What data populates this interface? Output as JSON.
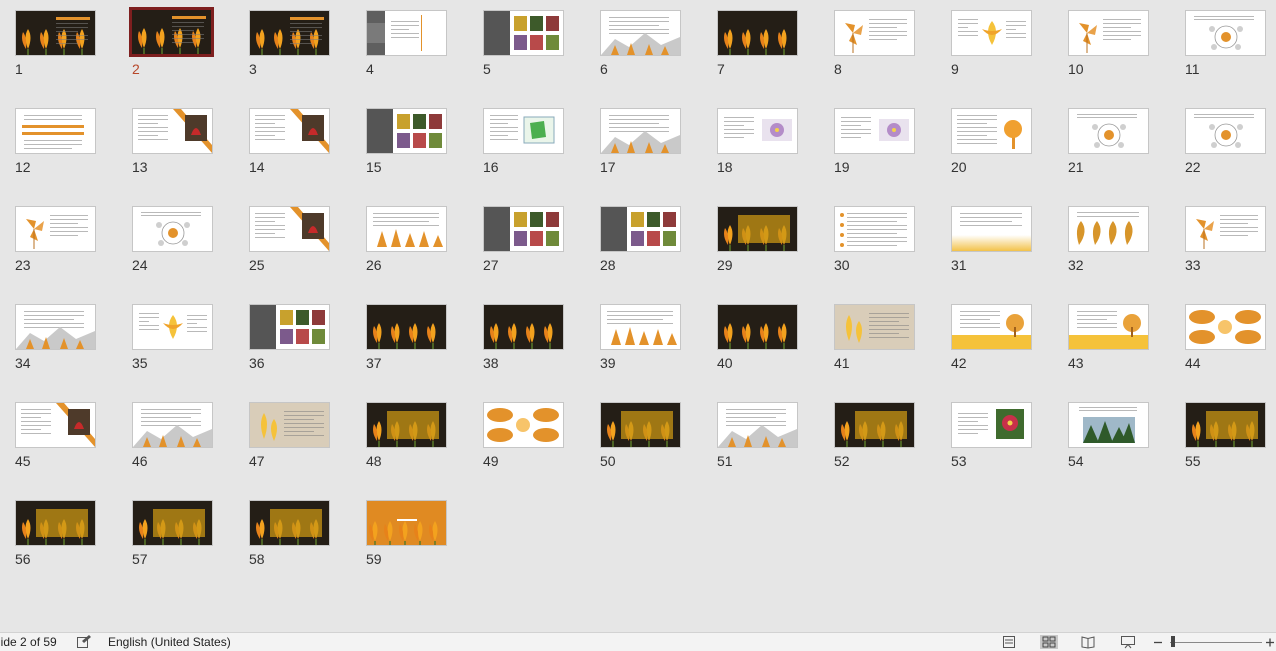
{
  "app": "PowerPoint Slide Sorter",
  "slides": {
    "selected": "2",
    "numbers": [
      "1",
      "2",
      "3",
      "4",
      "5",
      "6",
      "7",
      "8",
      "9",
      "10",
      "11",
      "12",
      "13",
      "14",
      "15",
      "16",
      "17",
      "18",
      "19",
      "20",
      "21",
      "22",
      "23",
      "24",
      "25",
      "26",
      "27",
      "28",
      "29",
      "30",
      "31",
      "32",
      "33",
      "34",
      "35",
      "36",
      "37",
      "38",
      "39",
      "40",
      "41",
      "42",
      "43",
      "44",
      "45",
      "46",
      "47",
      "48",
      "49",
      "50",
      "51",
      "52",
      "53",
      "54",
      "55",
      "56",
      "57",
      "58",
      "59"
    ],
    "kinds": [
      "dark",
      "dark",
      "dark",
      "grayband",
      "photos",
      "mountain",
      "dark",
      "pinwheel",
      "leafcenter",
      "pinwheel",
      "diagram",
      "stripes",
      "diagonal",
      "diagonal",
      "photos",
      "mapcard",
      "mountain",
      "purpleflower",
      "purpleflower",
      "treeright",
      "diagram",
      "diagram",
      "pinwheel",
      "diagram",
      "diagonal",
      "trees",
      "photos",
      "photos",
      "dark",
      "textlist",
      "honeyfooter",
      "leafrow",
      "pinwheel",
      "mountain",
      "leafcenter",
      "photos",
      "dark",
      "dark",
      "trees",
      "dark",
      "photofade",
      "yellowbase",
      "yellowbase",
      "ovals",
      "diagonal",
      "mountain",
      "photofade",
      "dark",
      "ovals",
      "dark",
      "mountain",
      "dark",
      "redflower",
      "forest",
      "dark",
      "dark",
      "dark",
      "dark",
      "orangefull"
    ]
  },
  "status": {
    "slide_indicator": "lide 2 of 59",
    "language": "English (United States)",
    "icons": [
      "notes-icon",
      "normal-view-icon",
      "slide-sorter-icon",
      "reading-view-icon",
      "slideshow-icon",
      "zoom-out-icon",
      "zoom-in-icon"
    ]
  },
  "colors": {
    "background": "#e6e6e6",
    "selection": "#7e1f1f",
    "selected_number": "#b7472a",
    "accent_orange": "#e3922b",
    "accent_yellow": "#f5c23a",
    "dark_slide": "#1e1a14"
  }
}
